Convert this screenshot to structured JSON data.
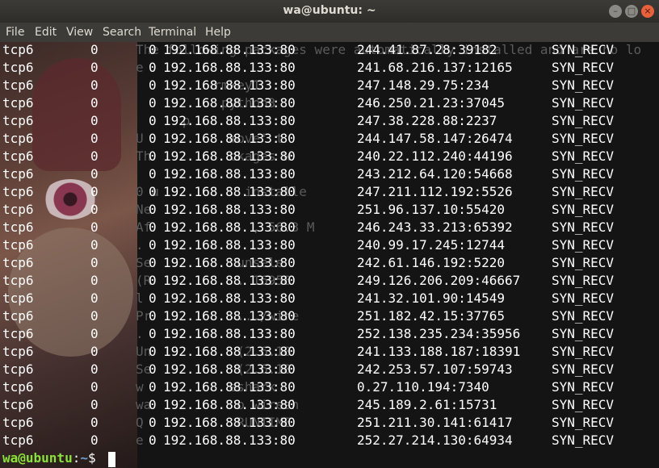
{
  "window": {
    "title": "wa@ubuntu: ~"
  },
  "menu": [
    "File",
    "Edit",
    "View",
    "Search",
    "Terminal",
    "Help"
  ],
  "background_text": [
    "The following packages were automatically installed and are no lo",
    "e",
    "          rmkey1 ",
    "           python3",
    "      p ",
    "U           move' t",
    "Th          ckages w",
    "  ",
    "0 u           installe",
    "Ne",
    "Af             , 56.3 M",
    ".  ",
    "Se           unsele",
    "(R           . 16958",
    "l ",
    "Pr           .../wire",
    ". ",
    "Un           (2.6.10",
    "Se           (2.6.10",
    "w           eshark",
    "wa           o wiresh",
    "Q            RUNTIME",
    "e "
  ],
  "netstat": [
    {
      "proto": "tcp6",
      "recvq": "0",
      "sendq": "0",
      "local": "192.168.88.133:80",
      "foreign": "244.41.87.28:39182",
      "state": "SYN_RECV"
    },
    {
      "proto": "tcp6",
      "recvq": "0",
      "sendq": "0",
      "local": "192.168.88.133:80",
      "foreign": "241.68.216.137:12165",
      "state": "SYN_RECV"
    },
    {
      "proto": "tcp6",
      "recvq": "0",
      "sendq": "0",
      "local": "192.168.88.133:80",
      "foreign": "247.148.29.75:234",
      "state": "SYN_RECV"
    },
    {
      "proto": "tcp6",
      "recvq": "0",
      "sendq": "0",
      "local": "192.168.88.133:80",
      "foreign": "246.250.21.23:37045",
      "state": "SYN_RECV"
    },
    {
      "proto": "tcp6",
      "recvq": "0",
      "sendq": "0",
      "local": "192.168.88.133:80",
      "foreign": "247.38.228.88:2237",
      "state": "SYN_RECV"
    },
    {
      "proto": "tcp6",
      "recvq": "0",
      "sendq": "0",
      "local": "192.168.88.133:80",
      "foreign": "244.147.58.147:26474",
      "state": "SYN_RECV"
    },
    {
      "proto": "tcp6",
      "recvq": "0",
      "sendq": "0",
      "local": "192.168.88.133:80",
      "foreign": "240.22.112.240:44196",
      "state": "SYN_RECV"
    },
    {
      "proto": "tcp6",
      "recvq": "0",
      "sendq": "0",
      "local": "192.168.88.133:80",
      "foreign": "243.212.64.120:54668",
      "state": "SYN_RECV"
    },
    {
      "proto": "tcp6",
      "recvq": "0",
      "sendq": "0",
      "local": "192.168.88.133:80",
      "foreign": "247.211.112.192:5526",
      "state": "SYN_RECV"
    },
    {
      "proto": "tcp6",
      "recvq": "0",
      "sendq": "0",
      "local": "192.168.88.133:80",
      "foreign": "251.96.137.10:55420",
      "state": "SYN_RECV"
    },
    {
      "proto": "tcp6",
      "recvq": "0",
      "sendq": "0",
      "local": "192.168.88.133:80",
      "foreign": "246.243.33.213:65392",
      "state": "SYN_RECV"
    },
    {
      "proto": "tcp6",
      "recvq": "0",
      "sendq": "0",
      "local": "192.168.88.133:80",
      "foreign": "240.99.17.245:12744",
      "state": "SYN_RECV"
    },
    {
      "proto": "tcp6",
      "recvq": "0",
      "sendq": "0",
      "local": "192.168.88.133:80",
      "foreign": "242.61.146.192:5220",
      "state": "SYN_RECV"
    },
    {
      "proto": "tcp6",
      "recvq": "0",
      "sendq": "0",
      "local": "192.168.88.133:80",
      "foreign": "249.126.206.209:46667",
      "state": "SYN_RECV"
    },
    {
      "proto": "tcp6",
      "recvq": "0",
      "sendq": "0",
      "local": "192.168.88.133:80",
      "foreign": "241.32.101.90:14549",
      "state": "SYN_RECV"
    },
    {
      "proto": "tcp6",
      "recvq": "0",
      "sendq": "0",
      "local": "192.168.88.133:80",
      "foreign": "251.182.42.15:37765",
      "state": "SYN_RECV"
    },
    {
      "proto": "tcp6",
      "recvq": "0",
      "sendq": "0",
      "local": "192.168.88.133:80",
      "foreign": "252.138.235.234:35956",
      "state": "SYN_RECV"
    },
    {
      "proto": "tcp6",
      "recvq": "0",
      "sendq": "0",
      "local": "192.168.88.133:80",
      "foreign": "241.133.188.187:18391",
      "state": "SYN_RECV"
    },
    {
      "proto": "tcp6",
      "recvq": "0",
      "sendq": "0",
      "local": "192.168.88.133:80",
      "foreign": "242.253.57.107:59743",
      "state": "SYN_RECV"
    },
    {
      "proto": "tcp6",
      "recvq": "0",
      "sendq": "0",
      "local": "192.168.88.133:80",
      "foreign": "0.27.110.194:7340",
      "state": "SYN_RECV"
    },
    {
      "proto": "tcp6",
      "recvq": "0",
      "sendq": "0",
      "local": "192.168.88.133:80",
      "foreign": "245.189.2.61:15731",
      "state": "SYN_RECV"
    },
    {
      "proto": "tcp6",
      "recvq": "0",
      "sendq": "0",
      "local": "192.168.88.133:80",
      "foreign": "251.211.30.141:61417",
      "state": "SYN_RECV"
    },
    {
      "proto": "tcp6",
      "recvq": "0",
      "sendq": "0",
      "local": "192.168.88.133:80",
      "foreign": "252.27.214.130:64934",
      "state": "SYN_RECV"
    }
  ],
  "prompt": {
    "user_host": "wa@ubuntu",
    "separator": ":",
    "path": "~",
    "symbol": "$ "
  },
  "colors": {
    "prompt_user": "#8ae234",
    "prompt_path": "#729fcf",
    "close_button": "#e8603c"
  },
  "icons": {
    "minimize": "minimize-icon",
    "maximize": "maximize-icon",
    "close": "close-icon"
  }
}
